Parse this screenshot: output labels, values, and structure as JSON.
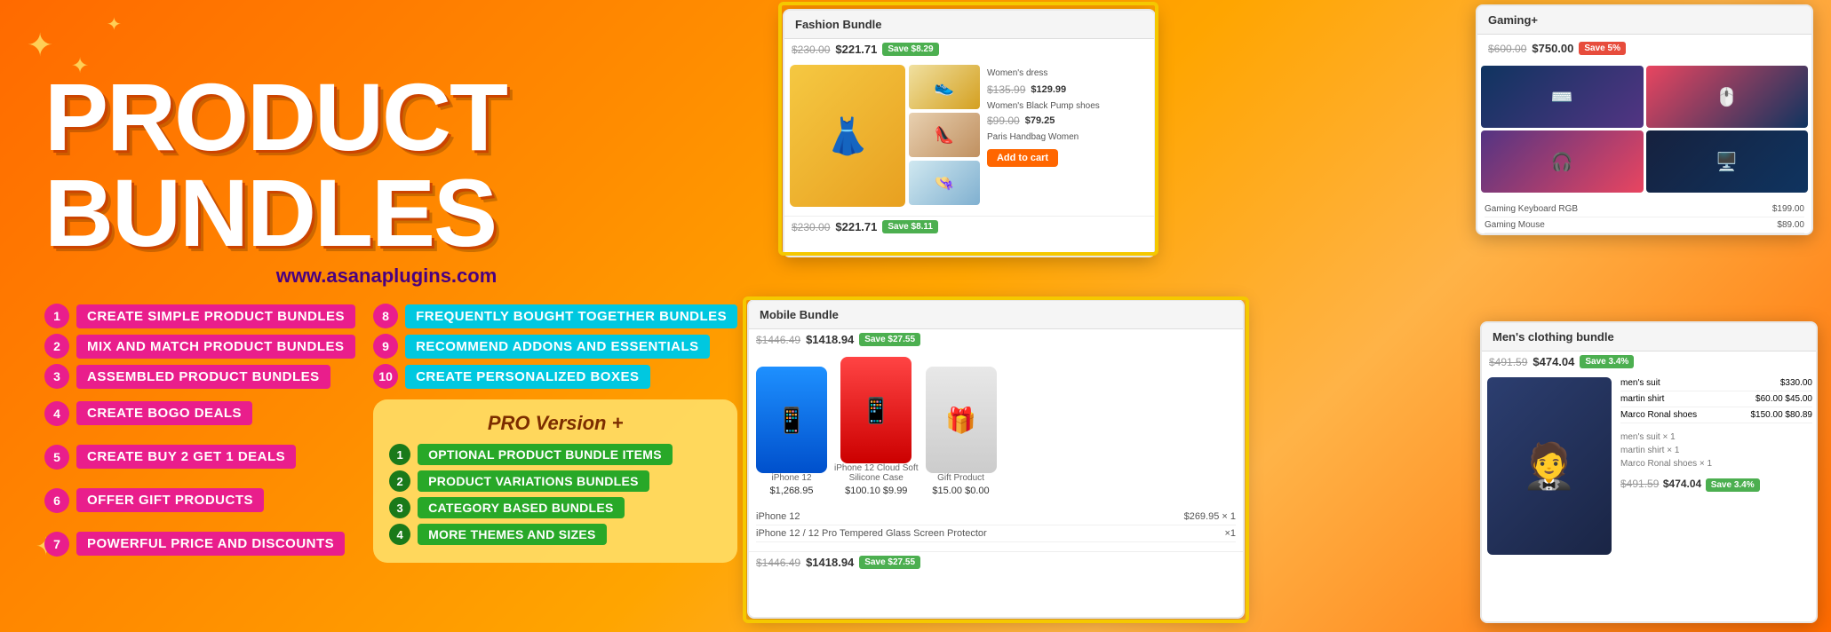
{
  "banner": {
    "title": "PRODUCT BUNDLES",
    "website": "www.asanaplugins.com",
    "features": [
      {
        "num": "1",
        "label": "CREATE SIMPLE PRODUCT BUNDLES"
      },
      {
        "num": "8",
        "label": "FREQUENTLY BOUGHT TOGETHER BUNDLES"
      },
      {
        "num": "2",
        "label": "MIX AND MATCH PRODUCT BUNDLES"
      },
      {
        "num": "9",
        "label": "RECOMMEND ADDONS AND ESSENTIALS"
      },
      {
        "num": "3",
        "label": "ASSEMBLED PRODUCT BUNDLES"
      },
      {
        "num": "10",
        "label": "CREATE PERSONALIZED BOXES"
      },
      {
        "num": "4",
        "label": "CREATE BOGO DEALS"
      },
      {
        "num": "5",
        "label": "CREATE BUY 2 GET 1 DEALS"
      },
      {
        "num": "6",
        "label": "OFFER GIFT PRODUCTS"
      },
      {
        "num": "7",
        "label": "POWERFUL PRICE AND DISCOUNTS"
      }
    ],
    "pro": {
      "title": "PRO Version +",
      "items": [
        {
          "num": "1",
          "label": "OPTIONAL PRODUCT BUNDLE ITEMS"
        },
        {
          "num": "2",
          "label": "PRODUCT VARIATIONS BUNDLES"
        },
        {
          "num": "3",
          "label": "CATEGORY BASED BUNDLES"
        },
        {
          "num": "4",
          "label": "MORE THEMES AND SIZES"
        }
      ]
    }
  },
  "screenshots": {
    "fashion": {
      "title": "Fashion Bundle",
      "price_old": "$230.00",
      "price_new": "$221.71",
      "badge": "Save $8.29"
    },
    "mobile": {
      "title": "Mobile Bundle",
      "price_old": "$1446.49",
      "price_new": "$1418.94",
      "badge": "Save $27.55",
      "phones": [
        {
          "name": "iPhone 12",
          "price": "$1,268.95",
          "color": "blue"
        },
        {
          "name": "iPhone 12 Cloud Soft Silicone Case",
          "price": "$100.10 $9.99",
          "color": "red"
        },
        {
          "name": "Gift Product",
          "price": "$15.00 $0.00",
          "color": "clear"
        }
      ]
    },
    "gaming": {
      "title": "Gaming+"
    },
    "mens": {
      "title": "Men's clothing bundle",
      "price_old": "$491.59",
      "price_new": "$474.04",
      "badge": "Save 3.4%"
    }
  },
  "stars": [
    "✦",
    "✦",
    "✦",
    "✦"
  ],
  "colors": {
    "pink": "#e91e8c",
    "cyan": "#00c8e0",
    "green": "#28a828",
    "orange_bg": "#ff8c00",
    "yellow_star": "#ffe066"
  }
}
